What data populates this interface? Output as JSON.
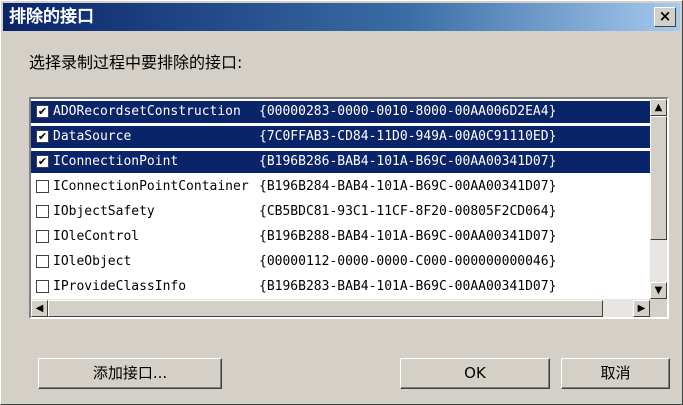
{
  "dialog": {
    "title": "排除的接口",
    "close_label": "×",
    "prompt": "选择录制过程中要排除的接口:"
  },
  "interfaces": [
    {
      "name": "ADORecordsetConstruction",
      "guid": "{00000283-0000-0010-8000-00AA006D2EA4}",
      "checked": true,
      "selected": true
    },
    {
      "name": "DataSource",
      "guid": "{7C0FFAB3-CD84-11D0-949A-00A0C91110ED}",
      "checked": true,
      "selected": true
    },
    {
      "name": "IConnectionPoint",
      "guid": "{B196B286-BAB4-101A-B69C-00AA00341D07}",
      "checked": true,
      "selected": true
    },
    {
      "name": "IConnectionPointContainer",
      "guid": "{B196B284-BAB4-101A-B69C-00AA00341D07}",
      "checked": false,
      "selected": false
    },
    {
      "name": "IObjectSafety",
      "guid": "{CB5BDC81-93C1-11CF-8F20-00805F2CD064}",
      "checked": false,
      "selected": false
    },
    {
      "name": "IOleControl",
      "guid": "{B196B288-BAB4-101A-B69C-00AA00341D07}",
      "checked": false,
      "selected": false
    },
    {
      "name": "IOleObject",
      "guid": "{00000112-0000-0000-C000-000000000046}",
      "checked": false,
      "selected": false
    },
    {
      "name": "IProvideClassInfo",
      "guid": "{B196B283-BAB4-101A-B69C-00AA00341D07}",
      "checked": false,
      "selected": false
    }
  ],
  "buttons": {
    "add": "添加接口...",
    "ok": "OK",
    "cancel": "取消"
  },
  "icons": {
    "check": "✔",
    "scroll_up": "▲",
    "scroll_down": "▼",
    "scroll_left": "◀",
    "scroll_right": "▶"
  }
}
